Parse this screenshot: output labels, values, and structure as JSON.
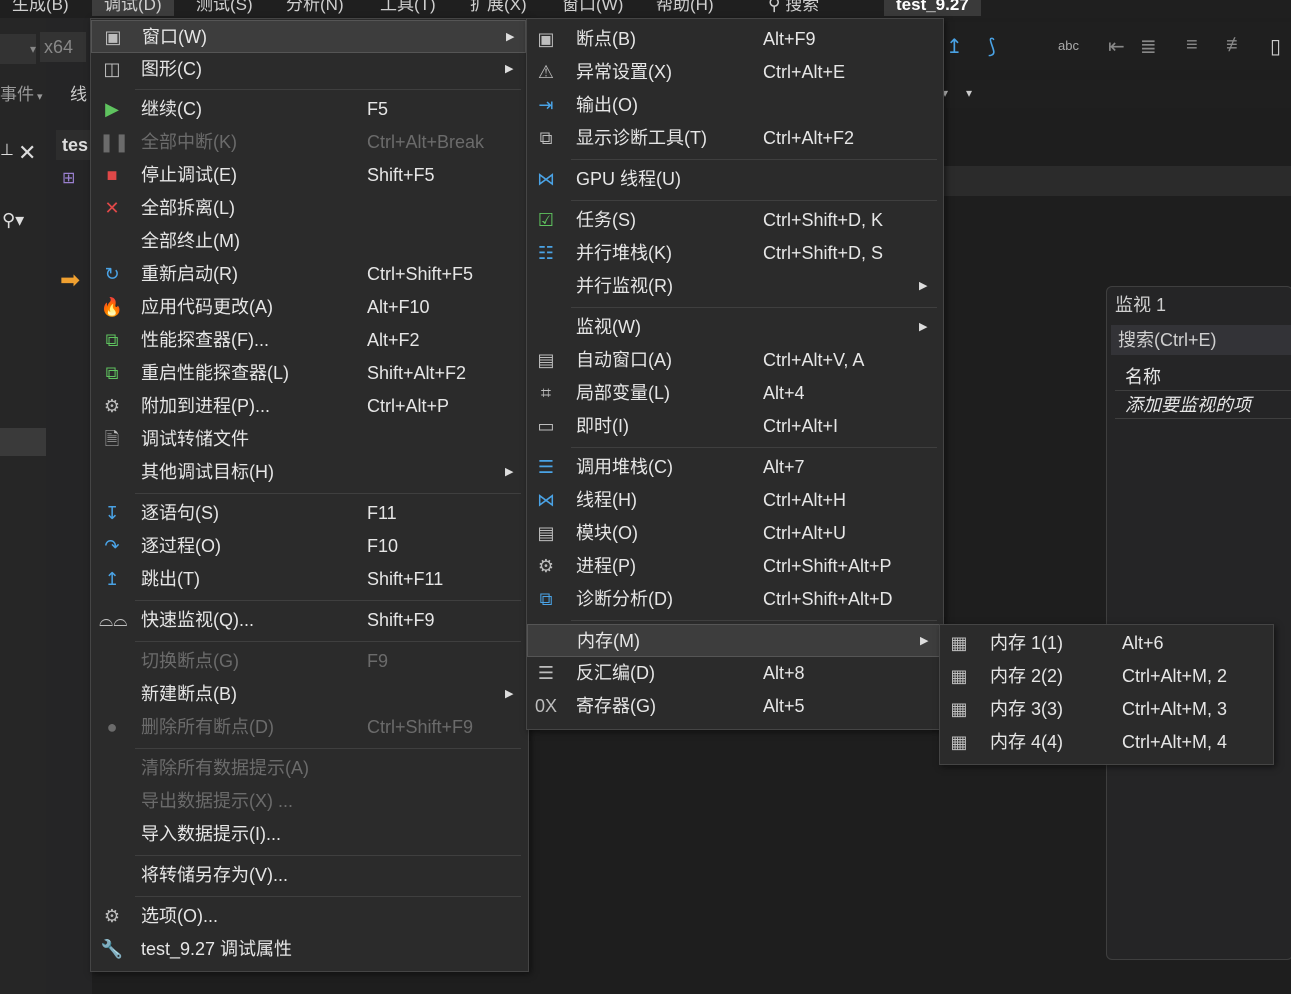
{
  "menubar": {
    "items": [
      "生成(B)",
      "调试(D)",
      "测试(S)",
      "分析(N)",
      "工具(T)",
      "扩展(X)",
      "窗口(W)",
      "帮助(H)",
      "搜索"
    ],
    "tab_title": "test_9.27"
  },
  "toolbar": {
    "platform": "x64",
    "event_label": "事件",
    "thread_label": "线"
  },
  "editor": {
    "tab_partial": "tes"
  },
  "watch": {
    "title": "监视 1",
    "search_placeholder": "搜索(Ctrl+E)",
    "column_name": "名称",
    "add_item_hint": "添加要监视的项"
  },
  "debug_menu": {
    "items": [
      {
        "icon": "window-icon",
        "label": "窗口(W)",
        "shortcut": "",
        "submenu": true,
        "highlighted": true
      },
      {
        "icon": "graphics-icon",
        "label": "图形(C)",
        "shortcut": "",
        "submenu": true
      },
      {
        "icon": "continue-icon",
        "label": "继续(C)",
        "shortcut": "F5"
      },
      {
        "icon": "pause-icon",
        "label": "全部中断(K)",
        "shortcut": "Ctrl+Alt+Break",
        "disabled": true
      },
      {
        "icon": "stop-icon",
        "label": "停止调试(E)",
        "shortcut": "Shift+F5"
      },
      {
        "icon": "detach-icon",
        "label": "全部拆离(L)",
        "shortcut": ""
      },
      {
        "icon": "",
        "label": "全部终止(M)",
        "shortcut": ""
      },
      {
        "icon": "restart-icon",
        "label": "重新启动(R)",
        "shortcut": "Ctrl+Shift+F5"
      },
      {
        "icon": "hot-reload-icon",
        "label": "应用代码更改(A)",
        "shortcut": "Alt+F10"
      },
      {
        "icon": "profiler-icon",
        "label": "性能探查器(F)...",
        "shortcut": "Alt+F2"
      },
      {
        "icon": "profiler-restart-icon",
        "label": "重启性能探查器(L)",
        "shortcut": "Shift+Alt+F2"
      },
      {
        "icon": "attach-process-icon",
        "label": "附加到进程(P)...",
        "shortcut": "Ctrl+Alt+P"
      },
      {
        "icon": "dump-file-icon",
        "label": "调试转储文件",
        "shortcut": ""
      },
      {
        "icon": "",
        "label": "其他调试目标(H)",
        "shortcut": "",
        "submenu": true
      },
      {
        "icon": "step-into-icon",
        "label": "逐语句(S)",
        "shortcut": "F11"
      },
      {
        "icon": "step-over-icon",
        "label": "逐过程(O)",
        "shortcut": "F10"
      },
      {
        "icon": "step-out-icon",
        "label": "跳出(T)",
        "shortcut": "Shift+F11"
      },
      {
        "icon": "quickwatch-icon",
        "label": "快速监视(Q)...",
        "shortcut": "Shift+F9"
      },
      {
        "icon": "",
        "label": "切换断点(G)",
        "shortcut": "F9",
        "disabled": true
      },
      {
        "icon": "",
        "label": "新建断点(B)",
        "shortcut": "",
        "submenu": true
      },
      {
        "icon": "delete-breakpoints-icon",
        "label": "删除所有断点(D)",
        "shortcut": "Ctrl+Shift+F9",
        "disabled": true
      },
      {
        "icon": "",
        "label": "清除所有数据提示(A)",
        "shortcut": "",
        "disabled": true
      },
      {
        "icon": "",
        "label": "导出数据提示(X) ...",
        "shortcut": "",
        "disabled": true
      },
      {
        "icon": "",
        "label": "导入数据提示(I)...",
        "shortcut": ""
      },
      {
        "icon": "",
        "label": "将转储另存为(V)...",
        "shortcut": ""
      },
      {
        "icon": "gear-icon",
        "label": "选项(O)...",
        "shortcut": ""
      },
      {
        "icon": "wrench-icon",
        "label": "test_9.27 调试属性",
        "shortcut": ""
      }
    ]
  },
  "window_menu": {
    "items": [
      {
        "icon": "breakpoints-icon",
        "label": "断点(B)",
        "shortcut": "Alt+F9"
      },
      {
        "icon": "exception-settings-icon",
        "label": "异常设置(X)",
        "shortcut": "Ctrl+Alt+E"
      },
      {
        "icon": "output-icon",
        "label": "输出(O)",
        "shortcut": ""
      },
      {
        "icon": "diagnostic-tools-icon",
        "label": "显示诊断工具(T)",
        "shortcut": "Ctrl+Alt+F2"
      },
      {
        "icon": "gpu-threads-icon",
        "label": "GPU 线程(U)",
        "shortcut": ""
      },
      {
        "icon": "tasks-icon",
        "label": "任务(S)",
        "shortcut": "Ctrl+Shift+D, K"
      },
      {
        "icon": "parallel-stacks-icon",
        "label": "并行堆栈(K)",
        "shortcut": "Ctrl+Shift+D, S"
      },
      {
        "icon": "",
        "label": "并行监视(R)",
        "shortcut": "",
        "submenu": true
      },
      {
        "icon": "",
        "label": "监视(W)",
        "shortcut": "",
        "submenu": true
      },
      {
        "icon": "autos-icon",
        "label": "自动窗口(A)",
        "shortcut": "Ctrl+Alt+V, A"
      },
      {
        "icon": "locals-icon",
        "label": "局部变量(L)",
        "shortcut": "Alt+4"
      },
      {
        "icon": "immediate-icon",
        "label": "即时(I)",
        "shortcut": "Ctrl+Alt+I"
      },
      {
        "icon": "call-stack-icon",
        "label": "调用堆栈(C)",
        "shortcut": "Alt+7"
      },
      {
        "icon": "threads-icon",
        "label": "线程(H)",
        "shortcut": "Ctrl+Alt+H"
      },
      {
        "icon": "modules-icon",
        "label": "模块(O)",
        "shortcut": "Ctrl+Alt+U"
      },
      {
        "icon": "processes-icon",
        "label": "进程(P)",
        "shortcut": "Ctrl+Shift+Alt+P"
      },
      {
        "icon": "diagnostic-analysis-icon",
        "label": "诊断分析(D)",
        "shortcut": "Ctrl+Shift+Alt+D"
      },
      {
        "icon": "",
        "label": "内存(M)",
        "shortcut": "",
        "submenu": true,
        "highlighted": true
      },
      {
        "icon": "disassembly-icon",
        "label": "反汇编(D)",
        "shortcut": "Alt+8"
      },
      {
        "icon": "registers-icon",
        "label": "寄存器(G)",
        "shortcut": "Alt+5"
      }
    ]
  },
  "memory_menu": {
    "items": [
      {
        "icon": "memory-icon",
        "label": "内存 1(1)",
        "shortcut": "Alt+6"
      },
      {
        "icon": "memory-icon",
        "label": "内存 2(2)",
        "shortcut": "Ctrl+Alt+M, 2"
      },
      {
        "icon": "memory-icon",
        "label": "内存 3(3)",
        "shortcut": "Ctrl+Alt+M, 3"
      },
      {
        "icon": "memory-icon",
        "label": "内存 4(4)",
        "shortcut": "Ctrl+Alt+M, 4"
      }
    ]
  }
}
